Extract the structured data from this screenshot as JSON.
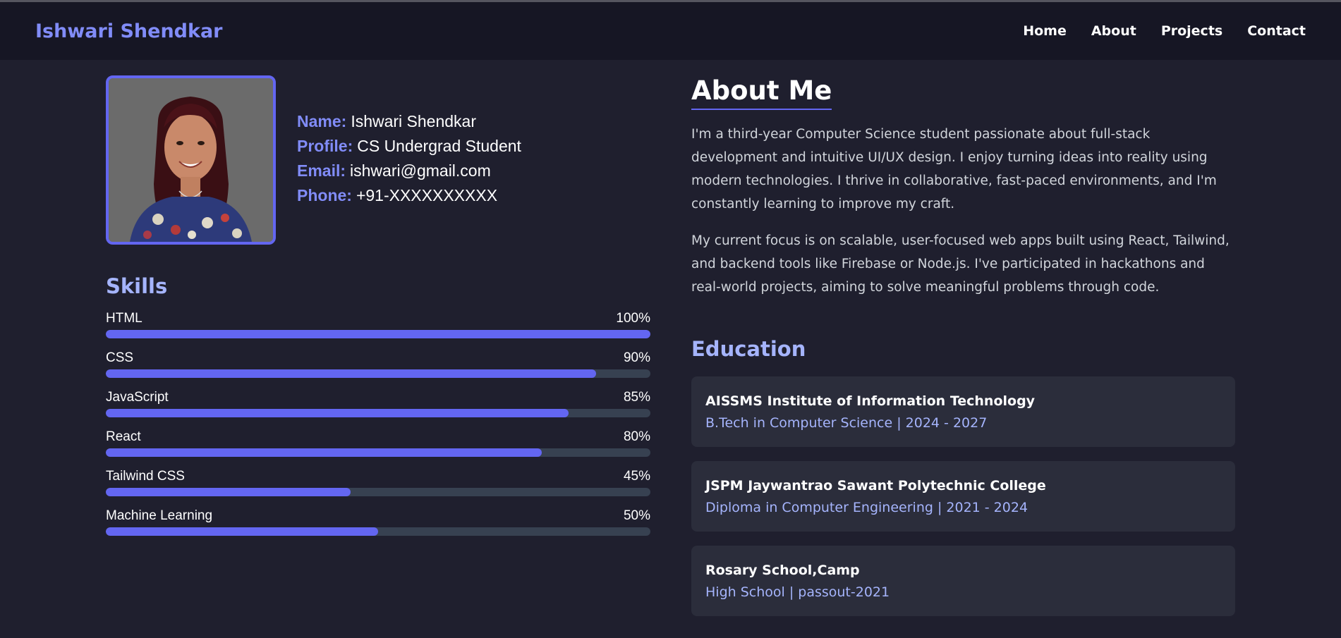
{
  "header": {
    "brand": "Ishwari Shendkar",
    "nav": [
      "Home",
      "About",
      "Projects",
      "Contact"
    ]
  },
  "profile": {
    "photo_alt": "profile photo",
    "fields": [
      {
        "key": "Name:",
        "value": "Ishwari Shendkar"
      },
      {
        "key": "Profile:",
        "value": "CS Undergrad Student"
      },
      {
        "key": "Email:",
        "value": "ishwari@gmail.com"
      },
      {
        "key": "Phone:",
        "value": "+91-XXXXXXXXXX"
      }
    ]
  },
  "skills": {
    "title": "Skills",
    "items": [
      {
        "name": "HTML",
        "percent_label": "100%",
        "level": 1.0
      },
      {
        "name": "CSS",
        "percent_label": "90%",
        "level": 0.9
      },
      {
        "name": "JavaScript",
        "percent_label": "85%",
        "level": 0.85
      },
      {
        "name": "React",
        "percent_label": "80%",
        "level": 0.8
      },
      {
        "name": "Tailwind CSS",
        "percent_label": "45%",
        "level": 0.45
      },
      {
        "name": "Machine Learning",
        "percent_label": "50%",
        "level": 0.5
      }
    ]
  },
  "about": {
    "title": "About Me",
    "paragraphs": [
      "I'm a third-year Computer Science student passionate about full-stack development and intuitive UI/UX design. I enjoy turning ideas into reality using modern technologies. I thrive in collaborative, fast-paced environments, and I'm constantly learning to improve my craft.",
      "My current focus is on scalable, user-focused web apps built using React, Tailwind, and backend tools like Firebase or Node.js. I've participated in hackathons and real-world projects, aiming to solve meaningful problems through code."
    ]
  },
  "education": {
    "title": "Education",
    "items": [
      {
        "school": "AISSMS Institute of Information Technology",
        "detail": "B.Tech in Computer Science | 2024 - 2027"
      },
      {
        "school": "JSPM Jaywantrao Sawant Polytechnic College",
        "detail": "Diploma in Computer Engineering | 2021 - 2024"
      },
      {
        "school": "Rosary School,Camp",
        "detail": "High School | passout-2021"
      }
    ]
  },
  "colors": {
    "accent": "#6366f1",
    "accent_text": "#818cf8",
    "background": "#1f1f2e",
    "navbar": "#161624",
    "card": "#2b2d3b",
    "track": "#374151"
  }
}
